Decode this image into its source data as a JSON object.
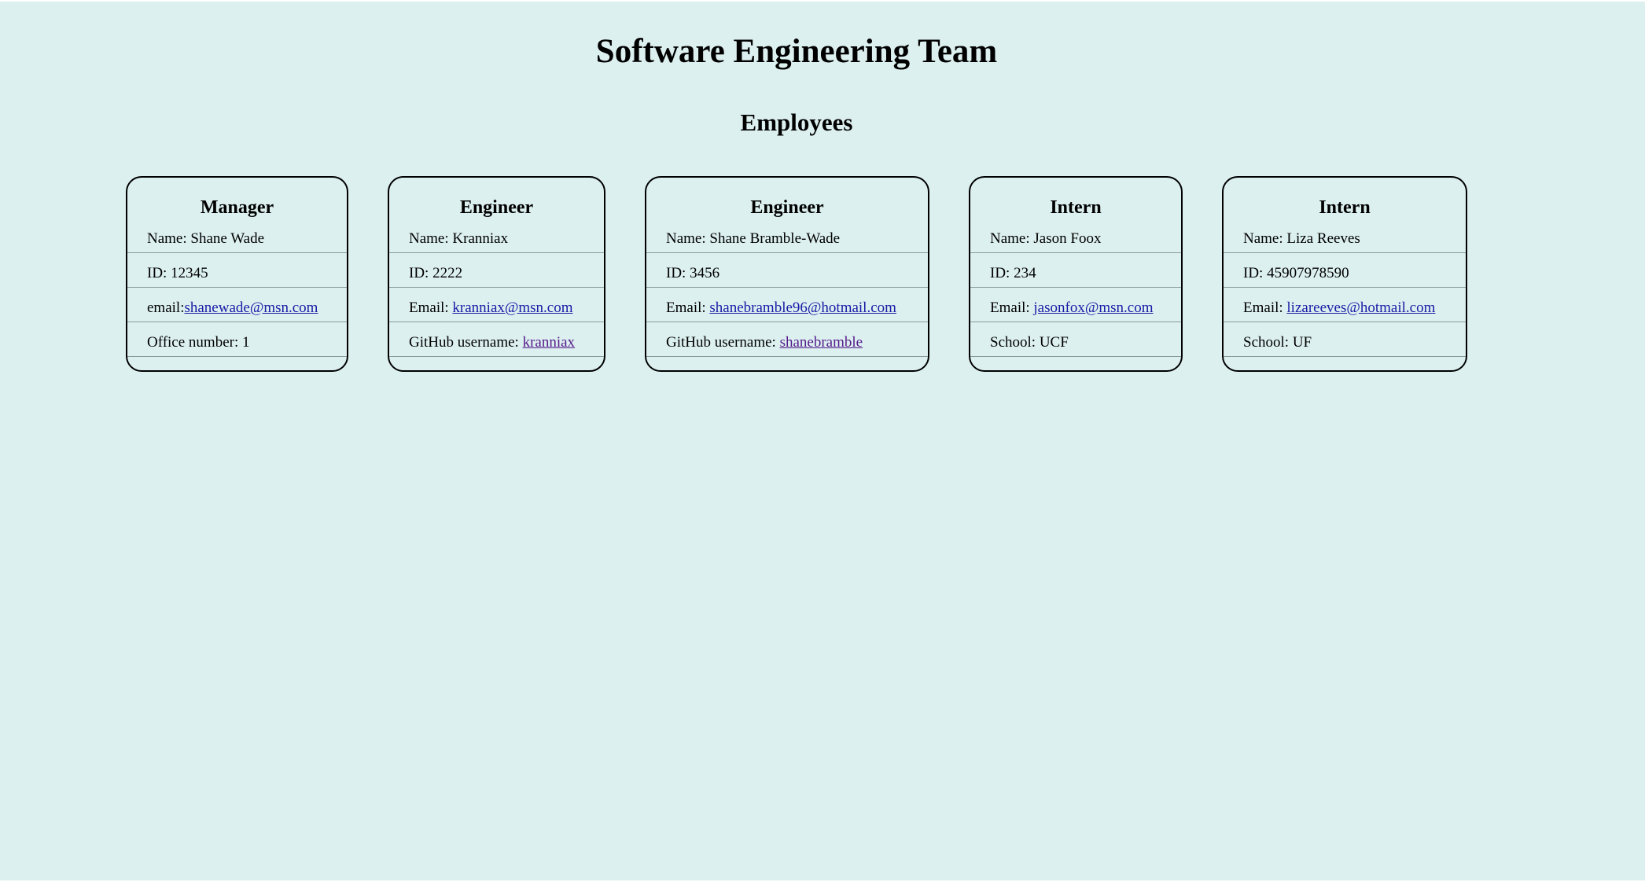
{
  "page": {
    "title": "Software Engineering Team",
    "section_title": "Employees"
  },
  "employees": [
    {
      "role": "Manager",
      "name_label": "Name: ",
      "name": "Shane Wade",
      "id_label": "ID: ",
      "id": "12345",
      "email_label": "email:",
      "email": "shanewade@msn.com",
      "extra_label": "Office number: ",
      "extra": "1"
    },
    {
      "role": "Engineer",
      "name_label": "Name: ",
      "name": "Kranniax",
      "id_label": "ID: ",
      "id": "2222",
      "email_label": "Email: ",
      "email": "kranniax@msn.com",
      "extra_label": "GitHub username: ",
      "extra": "kranniax"
    },
    {
      "role": "Engineer",
      "name_label": "Name: ",
      "name": "Shane Bramble-Wade",
      "id_label": "ID: ",
      "id": "3456",
      "email_label": "Email: ",
      "email": "shanebramble96@hotmail.com",
      "extra_label": "GitHub username: ",
      "extra": "shanebramble"
    },
    {
      "role": "Intern",
      "name_label": "Name: ",
      "name": "Jason Foox",
      "id_label": "ID: ",
      "id": "234",
      "email_label": "Email: ",
      "email": "jasonfox@msn.com",
      "extra_label": "School: ",
      "extra": "UCF"
    },
    {
      "role": "Intern",
      "name_label": "Name: ",
      "name": "Liza Reeves",
      "id_label": "ID: ",
      "id": "45907978590",
      "email_label": "Email: ",
      "email": "lizareeves@hotmail.com",
      "extra_label": "School: ",
      "extra": "UF"
    }
  ],
  "colors": {
    "background": "#dcf0ef",
    "email_link": "#1a1aa6",
    "visited_link": "#551a8b"
  }
}
